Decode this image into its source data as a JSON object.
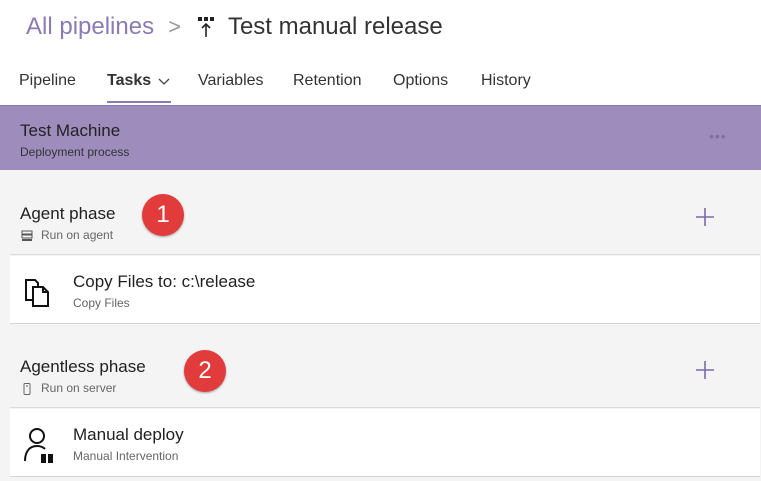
{
  "breadcrumb": {
    "parent": "All pipelines",
    "separator": ">",
    "title": "Test manual release"
  },
  "tabs": [
    {
      "label": "Pipeline"
    },
    {
      "label": "Tasks"
    },
    {
      "label": "Variables"
    },
    {
      "label": "Retention"
    },
    {
      "label": "Options"
    },
    {
      "label": "History"
    }
  ],
  "stage": {
    "title": "Test Machine",
    "subtitle": "Deployment process",
    "more": "•••"
  },
  "phases": [
    {
      "title": "Agent phase",
      "subtitle": "Run on agent",
      "badge": "1",
      "tasks": [
        {
          "title": "Copy Files to: c:\\release",
          "subtitle": "Copy Files",
          "icon": "copy-files-icon"
        }
      ]
    },
    {
      "title": "Agentless phase",
      "subtitle": "Run on server",
      "badge": "2",
      "tasks": [
        {
          "title": "Manual deploy",
          "subtitle": "Manual Intervention",
          "icon": "manual-intervention-icon"
        }
      ]
    }
  ],
  "colors": {
    "accent": "#8a7bb5",
    "stage_bg": "#9e8cbd",
    "badge": "#e23b3b"
  }
}
